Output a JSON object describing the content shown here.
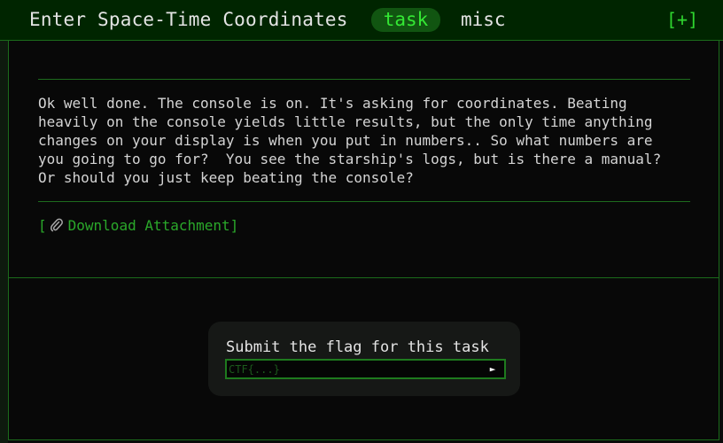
{
  "header": {
    "title": "Enter Space-Time Coordinates",
    "category_tag": "task",
    "category": "misc",
    "expand_label": "[+]"
  },
  "task": {
    "description": "Ok well done. The console is on. It's asking for coordinates. Beating\nheavily on the console yields little results, but the only time anything\nchanges on your display is when you put in numbers.. So what numbers are\nyou going to go for?  You see the starship's logs, but is there a manual?\nOr should you just keep beating the console?",
    "download_open": "[",
    "download_label": "Download Attachment",
    "download_close": "]",
    "download_icon": "paperclip-icon"
  },
  "flag_form": {
    "label": "Submit the flag for this task",
    "placeholder": "CTF{...}",
    "value": "",
    "submit_glyph": "►"
  },
  "colors": {
    "accent": "#2fd62f",
    "header_bg": "#002500",
    "border": "#1b6b1b",
    "background": "#080808"
  }
}
